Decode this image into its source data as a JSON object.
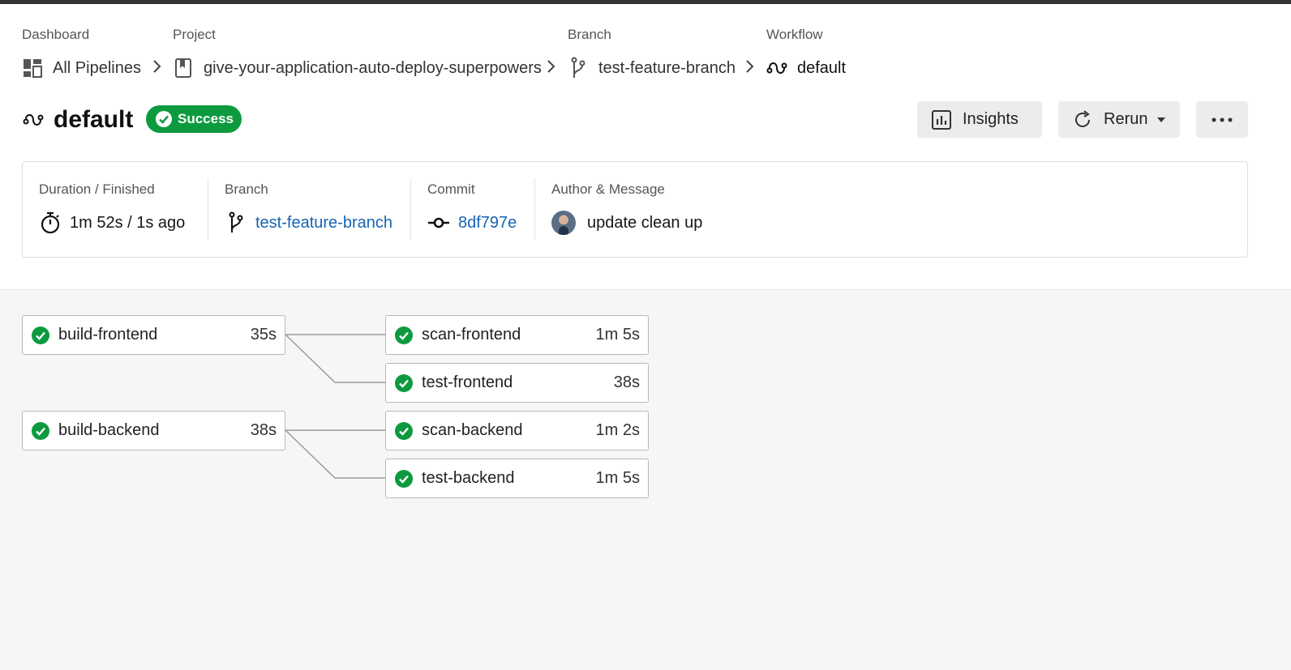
{
  "breadcrumb": {
    "dashboard": {
      "label": "Dashboard",
      "value": "All Pipelines"
    },
    "project": {
      "label": "Project",
      "value": "give-your-application-auto-deploy-superpowers"
    },
    "branch": {
      "label": "Branch",
      "value": "test-feature-branch"
    },
    "workflow": {
      "label": "Workflow",
      "value": "default"
    }
  },
  "header": {
    "workflow_name": "default",
    "status": "Success",
    "status_color": "#0d9a3f",
    "insights_label": "Insights",
    "rerun_label": "Rerun"
  },
  "info": {
    "duration_label": "Duration / Finished",
    "duration_value": "1m 52s / 1s ago",
    "branch_label": "Branch",
    "branch_value": "test-feature-branch",
    "commit_label": "Commit",
    "commit_value": "8df797e",
    "author_label": "Author & Message",
    "message": "update clean up",
    "link_color": "#1564b4"
  },
  "jobs": [
    {
      "name": "build-frontend",
      "duration": "35s",
      "status": "success"
    },
    {
      "name": "scan-frontend",
      "duration": "1m 5s",
      "status": "success"
    },
    {
      "name": "test-frontend",
      "duration": "38s",
      "status": "success"
    },
    {
      "name": "build-backend",
      "duration": "38s",
      "status": "success"
    },
    {
      "name": "scan-backend",
      "duration": "1m 2s",
      "status": "success"
    },
    {
      "name": "test-backend",
      "duration": "1m 5s",
      "status": "success"
    }
  ]
}
